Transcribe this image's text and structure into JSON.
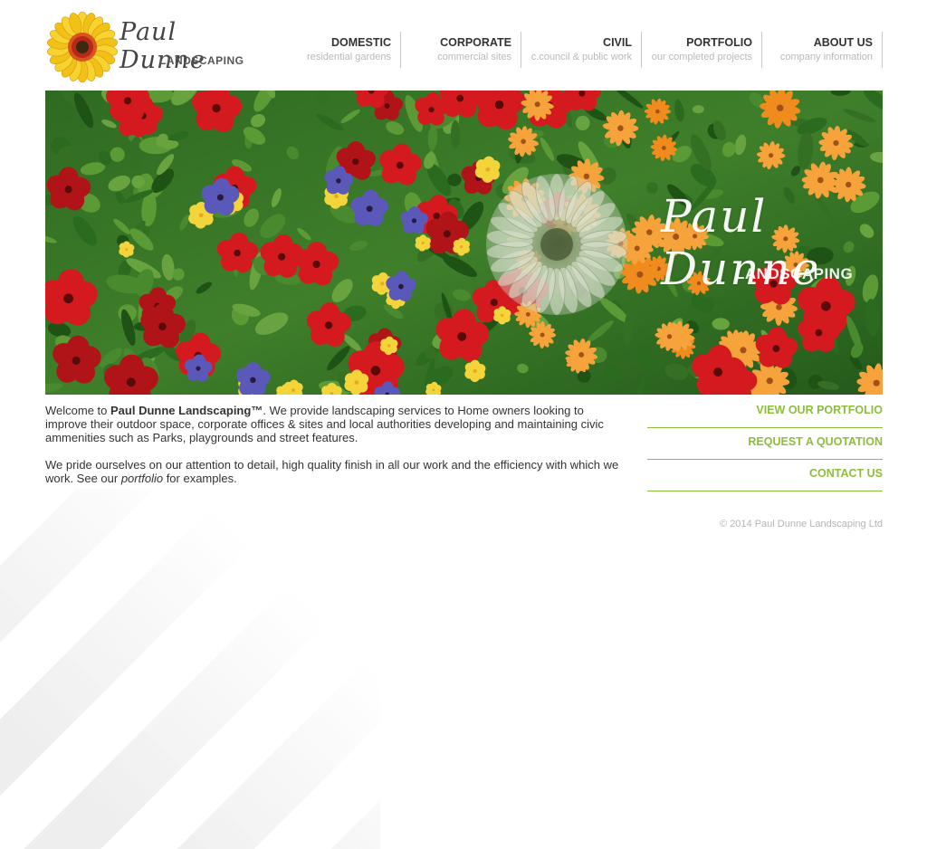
{
  "logo": {
    "signature": "Paul Dunne",
    "subtitle": "LANDSCAPING"
  },
  "nav": [
    {
      "title": "DOMESTIC",
      "subtitle": "residential gardens"
    },
    {
      "title": "CORPORATE",
      "subtitle": "commercial sites"
    },
    {
      "title": "CIVIL",
      "subtitle": "c.council & public work"
    },
    {
      "title": "PORTFOLIO",
      "subtitle": "our completed projects"
    },
    {
      "title": "ABOUT US",
      "subtitle": "company information"
    }
  ],
  "hero": {
    "signature": "Paul Dunne",
    "subtitle": "LANDSCAPING"
  },
  "intro": {
    "p1_prefix": "Welcome to ",
    "p1_brand": "Paul Dunne Landscaping™",
    "p1_rest": ". We provide landscaping services to Home owners looking to improve their outdoor space, corporate offices & sites and local authorities developing and maintaining civic ammenities such as Parks, playgrounds and street features.",
    "p2_prefix": "We pride ourselves on our attention to detail, high quality finish in all our work and the efficiency with which we work. See our ",
    "p2_link": "portfolio",
    "p2_suffix": " for examples."
  },
  "side_links": {
    "portfolio": "VIEW OUR PORTFOLIO",
    "quotation": "REQUEST A QUOTATION",
    "contact": "CONTACT US"
  },
  "footer": {
    "copyright": "© 2014 Paul Dunne Landscaping Ltd"
  },
  "colors": {
    "accent_green": "#8cbe3c",
    "nav_subtitle": "#b9b9b9",
    "text": "#333333"
  }
}
